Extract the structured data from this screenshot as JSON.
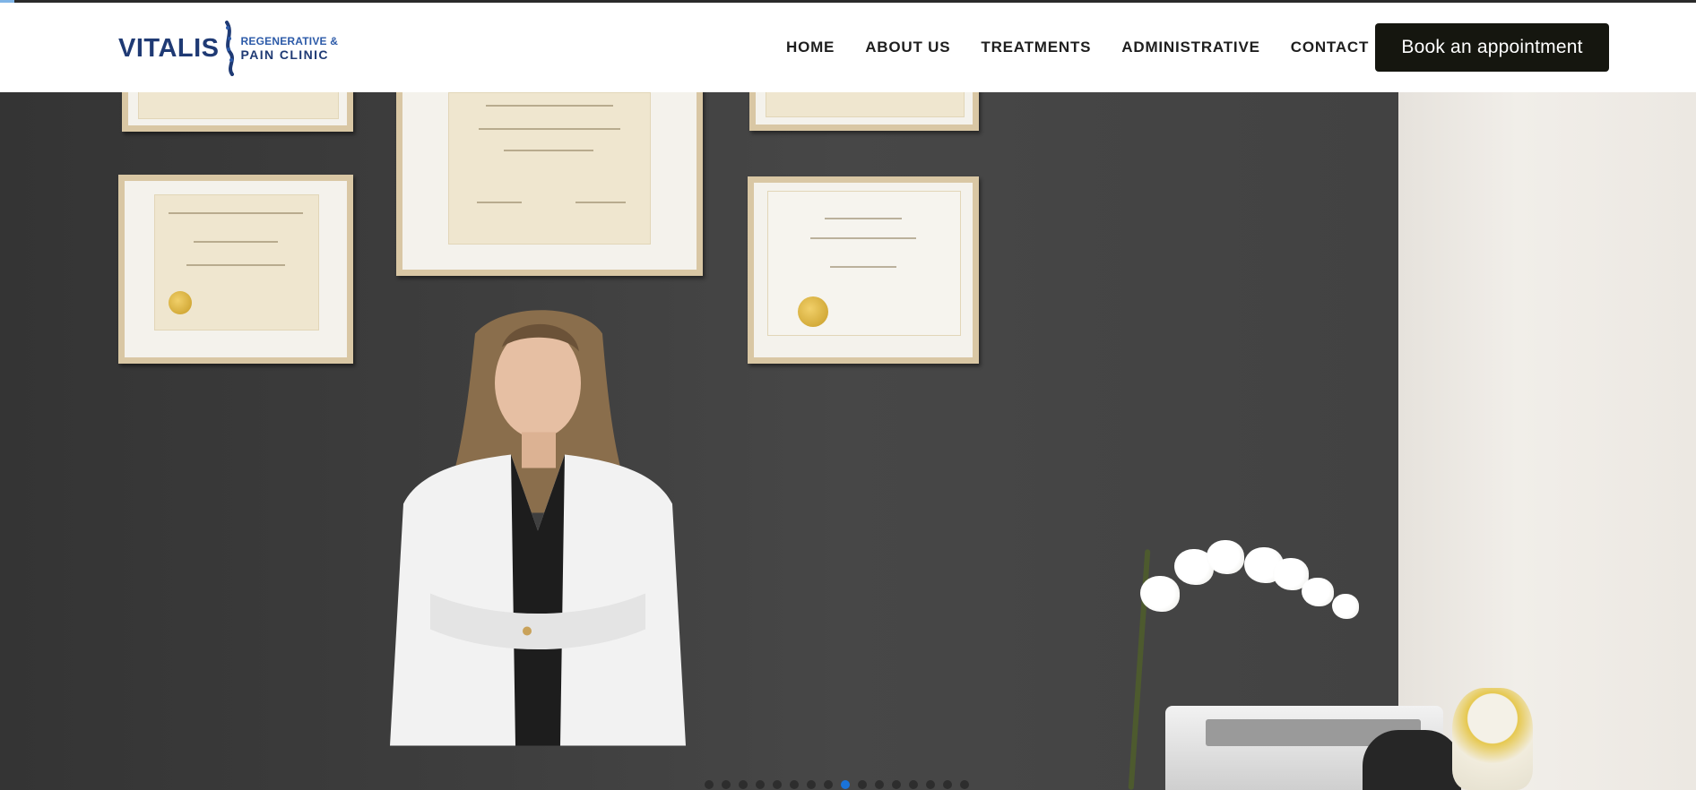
{
  "brand": {
    "name": "VITALIS",
    "sub_line_1": "REGENERATIVE &",
    "sub_line_2": "PAIN CLINIC",
    "color": "#1f3a74"
  },
  "nav": {
    "items": [
      {
        "label": "HOME"
      },
      {
        "label": "ABOUT US"
      },
      {
        "label": "TREATMENTS"
      },
      {
        "label": "ADMINISTRATIVE"
      },
      {
        "label": "CONTACT"
      }
    ]
  },
  "cta": {
    "label": "Book an appointment",
    "background": "#15160f"
  },
  "hero": {
    "slide_count": 16,
    "active_slide": 9,
    "dot_active_color": "#1a73d9"
  }
}
